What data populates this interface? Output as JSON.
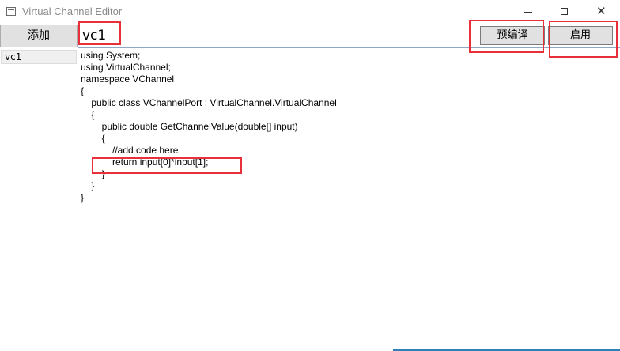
{
  "window": {
    "title": "Virtual Channel Editor",
    "controls": {
      "minimize": "minimize-icon",
      "maximize": "maximize-icon",
      "close": "close-icon",
      "close_glyph": "✕"
    }
  },
  "sidebar": {
    "add_label": "添加",
    "items": [
      {
        "label": "vc1"
      }
    ]
  },
  "toolbar": {
    "name_value": "vc1",
    "precompile_label": "预编译",
    "enable_label": "启用"
  },
  "editor": {
    "lines": [
      "using System;",
      "using VirtualChannel;",
      "namespace VChannel",
      "{",
      "    public class VChannelPort : VirtualChannel.VirtualChannel",
      "    {",
      "        public double GetChannelValue(double[] input)",
      "        {",
      "            //add code here",
      "            return input[0]*input[1];",
      "        }",
      "    }",
      "}"
    ]
  },
  "colors": {
    "highlight": "#e8303a",
    "panel_border": "#8fa8c8",
    "button_bg": "#e1e1e1"
  }
}
